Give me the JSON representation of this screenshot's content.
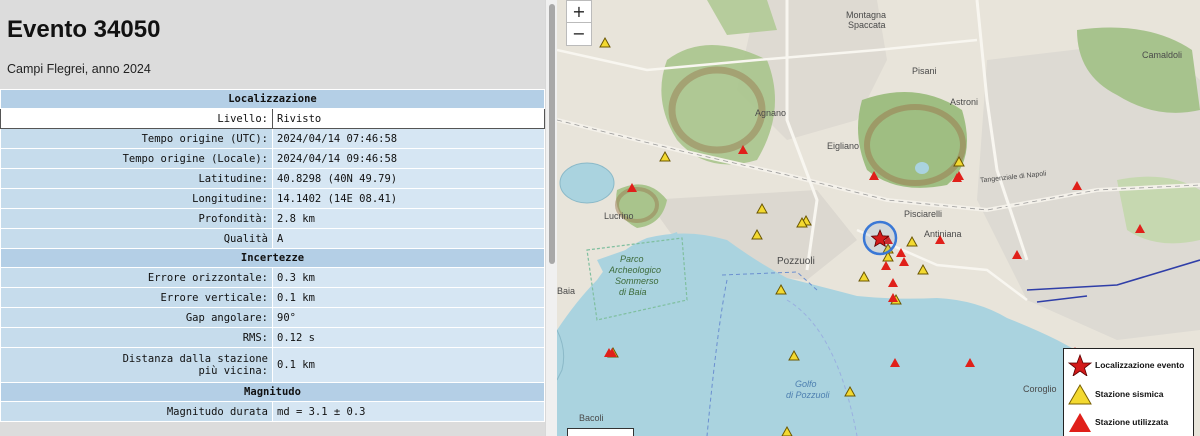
{
  "page": {
    "title": "Evento 34050",
    "subtitle": "Campi Flegrei, anno 2024"
  },
  "sections": {
    "localizzazione": "Localizzazione",
    "incertezze": "Incertezze",
    "magnitudo": "Magnitudo"
  },
  "fields": {
    "livello": {
      "label": "Livello:",
      "value": "Rivisto"
    },
    "tempo_utc": {
      "label": "Tempo origine (UTC):",
      "value": "2024/04/14 07:46:58"
    },
    "tempo_locale": {
      "label": "Tempo origine (Locale):",
      "value": "2024/04/14 09:46:58"
    },
    "latitudine": {
      "label": "Latitudine:",
      "value": "40.8298 (40N 49.79)"
    },
    "longitudine": {
      "label": "Longitudine:",
      "value": "14.1402 (14E 08.41)"
    },
    "profondita": {
      "label": "Profondità:",
      "value": "2.8 km"
    },
    "qualita": {
      "label": "Qualità",
      "value": "A"
    },
    "err_orizz": {
      "label": "Errore orizzontale:",
      "value": "0.3 km"
    },
    "err_vert": {
      "label": "Errore verticale:",
      "value": "0.1 km"
    },
    "gap": {
      "label": "Gap angolare:",
      "value": "90°"
    },
    "rms": {
      "label": "RMS:",
      "value": "0.12 s"
    },
    "distanza_l1": "Distanza dalla stazione",
    "distanza_l2": "più vicina:",
    "distanza_val": "0.1 km",
    "magnitudo_durata": {
      "label": "Magnitudo durata",
      "value": "md = 3.1 ± 0.3"
    }
  },
  "map": {
    "zoom_in": "+",
    "zoom_out": "−",
    "labels": {
      "montagna_1": "Montagna",
      "montagna_2": "Spaccata",
      "pisani": "Pisani",
      "camaldoli": "Camaldoli",
      "astroni": "Astroni",
      "agnano": "Agnano",
      "eigliano": "Eigliano",
      "pisciarelli": "Pisciarelli",
      "antiniana": "Antiniana",
      "lucrino": "Lucrino",
      "pozzuoli": "Pozzuoli",
      "baia": "Baia",
      "bacoli": "Bacoli",
      "coroglio": "Coroglio",
      "parco_1": "Parco",
      "parco_2": "Archeologico",
      "parco_3": "Sommerso",
      "parco_4": "di Baia",
      "golfo_1": "Golfo",
      "golfo_2": "di Pozzuoli",
      "tangenziale": "Tangenziale di Napoli"
    },
    "legend": {
      "event": "Localizzazione evento",
      "seismic": "Stazione sismica",
      "used": "Stazione utilizzata"
    },
    "colors": {
      "event": "#d31a1a",
      "seismic_fill": "#f3d930",
      "used": "#e0201a",
      "sea": "#aad3df",
      "circle": "#3a78d6"
    },
    "seismic_stations": 18,
    "used_stations": 20
  }
}
